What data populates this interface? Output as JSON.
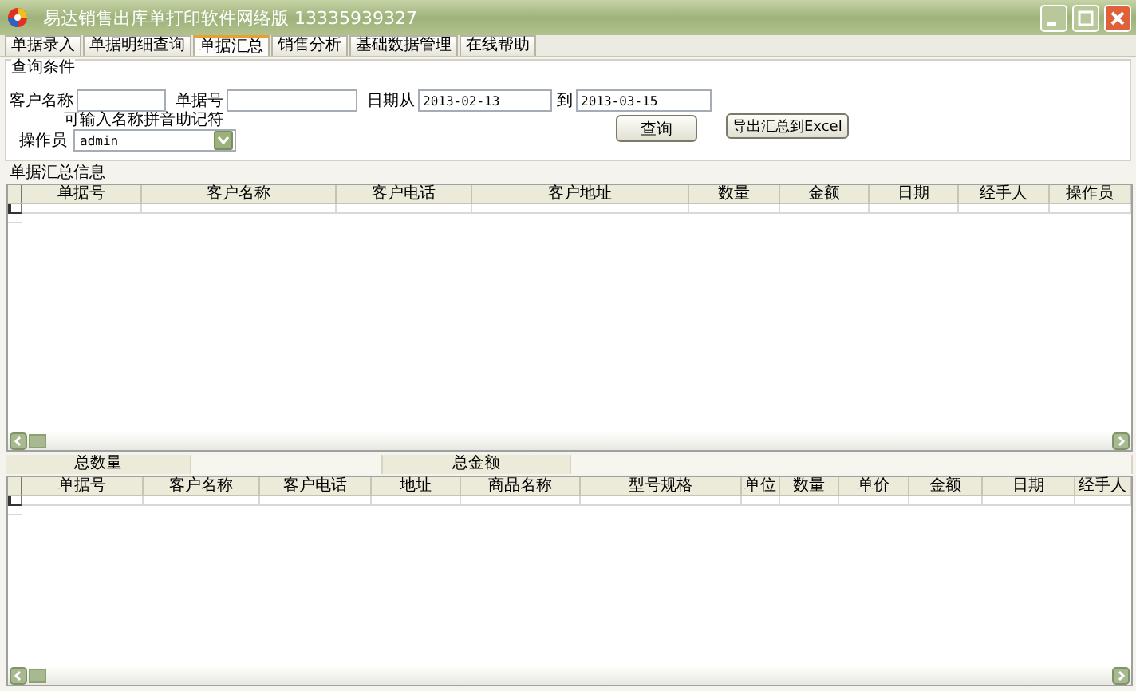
{
  "window": {
    "title": "易达销售出库单打印软件网络版 13335939327"
  },
  "tabs": [
    {
      "label": "单据录入",
      "selected": false
    },
    {
      "label": "单据明细查询",
      "selected": false
    },
    {
      "label": "单据汇总",
      "selected": true
    },
    {
      "label": "销售分析",
      "selected": false
    },
    {
      "label": "基础数据管理",
      "selected": false
    },
    {
      "label": "在线帮助",
      "selected": false
    }
  ],
  "query": {
    "title": "查询条件",
    "customer_label": "客户名称",
    "order_no_label": "单据号",
    "date_from_label": "日期从",
    "date_from": "2013-02-13",
    "date_to_label": "到",
    "date_to": "2013-03-15",
    "hint": "可输入名称拼音助记符",
    "operator_label": "操作员",
    "operator": "admin",
    "buttons": [
      "查询",
      "导出汇总到Excel"
    ]
  },
  "summary_table": {
    "title": "单据汇总信息",
    "columns": [
      "单据号",
      "客户名称",
      "客户电话",
      "客户地址",
      "数量",
      "金额",
      "日期",
      "经手人",
      "操作员"
    ]
  },
  "totals": [
    "总数量",
    "总金额"
  ],
  "detail_table": {
    "columns": [
      "单据号",
      "客户名称",
      "客户电话",
      "地址",
      "商品名称",
      "型号规格",
      "单位",
      "数量",
      "单价",
      "金额",
      "日期",
      "经手人"
    ]
  }
}
